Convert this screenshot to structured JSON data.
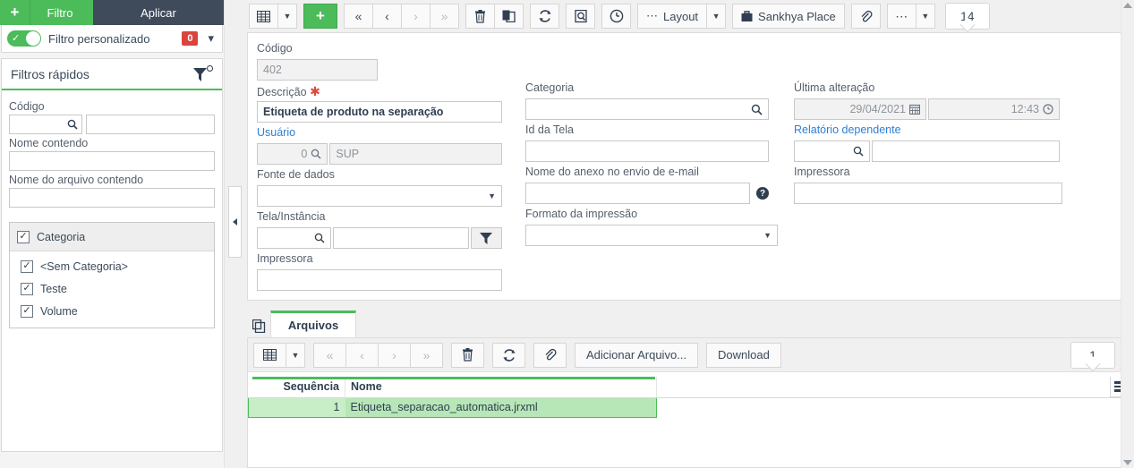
{
  "sidebar": {
    "add_label": "+",
    "filter_label": "Filtro",
    "apply_label": "Aplicar",
    "custom_filter": {
      "label": "Filtro personalizado",
      "count": "0",
      "enabled": true
    },
    "quick_filters": {
      "title": "Filtros rápidos",
      "fields": [
        {
          "label": "Código",
          "value": "",
          "value2": "",
          "type": "search-pair"
        },
        {
          "label": "Nome contendo",
          "value": "",
          "type": "text"
        },
        {
          "label": "Nome do arquivo contendo",
          "value": "",
          "type": "text"
        }
      ],
      "category_group": {
        "header": "Categoria",
        "checked": true,
        "items": [
          {
            "label": "<Sem Categoria>",
            "checked": true
          },
          {
            "label": "Teste",
            "checked": true
          },
          {
            "label": "Volume",
            "checked": true
          }
        ]
      }
    }
  },
  "toolbar": {
    "buttons": [
      {
        "name": "grid-view",
        "icon": "grid-icon"
      },
      {
        "name": "grid-view-dropdown",
        "icon": "caret-down-icon"
      },
      {
        "name": "add-record",
        "icon": "plus-icon"
      },
      {
        "name": "first-record",
        "icon": "double-chevron-left-icon"
      },
      {
        "name": "previous-record",
        "icon": "chevron-left-icon"
      },
      {
        "name": "next-record",
        "icon": "chevron-right-icon"
      },
      {
        "name": "last-record",
        "icon": "double-chevron-right-icon"
      },
      {
        "name": "delete-record",
        "icon": "trash-icon"
      },
      {
        "name": "duplicate-record",
        "icon": "copy-icon"
      },
      {
        "name": "refresh",
        "icon": "refresh-icon"
      },
      {
        "name": "report",
        "icon": "report-icon"
      },
      {
        "name": "schedule",
        "icon": "clock-icon"
      }
    ],
    "layout_label": "Layout",
    "sankhya_place_label": "Sankhya Place",
    "attachment_icon": "paperclip-icon",
    "more_icon": "ellipsis-icon",
    "record_count": "14"
  },
  "form": {
    "codigo": {
      "label": "Código",
      "value": "402",
      "readonly": true
    },
    "descricao": {
      "label": "Descrição",
      "required": true,
      "value": "Etiqueta de produto na separação"
    },
    "usuario": {
      "label": "Usuário",
      "code": "0",
      "name": "SUP",
      "is_link": true
    },
    "fonte_dados": {
      "label": "Fonte de dados",
      "value": ""
    },
    "tela_instancia": {
      "label": "Tela/Instância",
      "code": "",
      "value": ""
    },
    "impressora_left": {
      "label": "Impressora",
      "value": ""
    },
    "categoria": {
      "label": "Categoria",
      "value": ""
    },
    "id_tela": {
      "label": "Id da Tela",
      "value": ""
    },
    "nome_anexo": {
      "label": "Nome do anexo no envio de e-mail",
      "value": ""
    },
    "formato_impressao": {
      "label": "Formato da impressão",
      "value": ""
    },
    "ultima_alteracao": {
      "label": "Última alteração",
      "date": "29/04/2021",
      "time": "12:43"
    },
    "relatorio_dependente": {
      "label": "Relatório dependente",
      "code": "",
      "value": "",
      "is_link": true
    },
    "impressora_right": {
      "label": "Impressora",
      "value": ""
    }
  },
  "tabs": {
    "copy_icon": "copy-tab-icon",
    "items": [
      {
        "label": "Arquivos",
        "active": true
      }
    ]
  },
  "grid_toolbar": {
    "buttons": [
      {
        "name": "grid-view",
        "icon": "grid-icon"
      },
      {
        "name": "grid-view-dropdown",
        "icon": "caret-down-icon"
      },
      {
        "name": "first-row",
        "icon": "double-chevron-left-icon"
      },
      {
        "name": "previous-row",
        "icon": "chevron-left-icon"
      },
      {
        "name": "next-row",
        "icon": "chevron-right-icon"
      },
      {
        "name": "last-row",
        "icon": "double-chevron-right-icon"
      },
      {
        "name": "delete-row",
        "icon": "trash-icon"
      },
      {
        "name": "refresh-grid",
        "icon": "refresh-icon"
      },
      {
        "name": "attach",
        "icon": "paperclip-icon"
      }
    ],
    "add_file_label": "Adicionar Arquivo...",
    "download_label": "Download",
    "row_count": "1"
  },
  "grid": {
    "columns": [
      "Sequência",
      "Nome"
    ],
    "rows": [
      {
        "sequencia": "1",
        "nome": "Etiqueta_separacao_automatica.jrxml",
        "selected": true
      }
    ],
    "menu_icon": "hamburger-menu-icon"
  },
  "colors": {
    "green": "#4cbb5a",
    "dark": "#3f4a5a",
    "red": "#d9453e",
    "link": "#2f7fd4",
    "row_selected": "#b7e6b7"
  }
}
